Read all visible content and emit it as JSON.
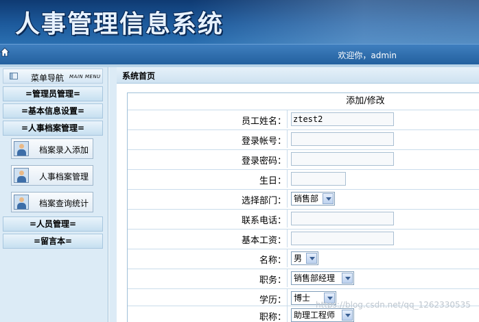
{
  "app": {
    "title": "人事管理信息系统",
    "welcome": "欢迎你，admin"
  },
  "sidebar": {
    "header_title": "菜单导航",
    "header_sub": "MAIN MENU",
    "sections": [
      {
        "label": "=管理员管理="
      },
      {
        "label": "=基本信息设置="
      },
      {
        "label": "=人事档案管理="
      },
      {
        "label": "=人员管理="
      },
      {
        "label": "=留言本="
      }
    ],
    "items": [
      {
        "label": "档案录入添加"
      },
      {
        "label": "人事档案管理"
      },
      {
        "label": "档案查询统计"
      }
    ]
  },
  "main": {
    "title": "系统首页",
    "form": {
      "title": "添加/修改",
      "fields": [
        {
          "label": "员工姓名：",
          "value": "ztest2"
        },
        {
          "label": "登录帐号：",
          "value": ""
        },
        {
          "label": "登录密码：",
          "value": ""
        },
        {
          "label": "生日：",
          "value": ""
        },
        {
          "label": "选择部门：",
          "value": "销售部"
        },
        {
          "label": "联系电话：",
          "value": ""
        },
        {
          "label": "基本工资：",
          "value": ""
        },
        {
          "label": "名称：",
          "value": "男"
        },
        {
          "label": "职务：",
          "value": "销售部经理"
        },
        {
          "label": "学历：",
          "value": "博士"
        },
        {
          "label": "职称：",
          "value": "助理工程师"
        }
      ]
    }
  },
  "watermark": "https://blog.csdn.net/qq_1262330535"
}
